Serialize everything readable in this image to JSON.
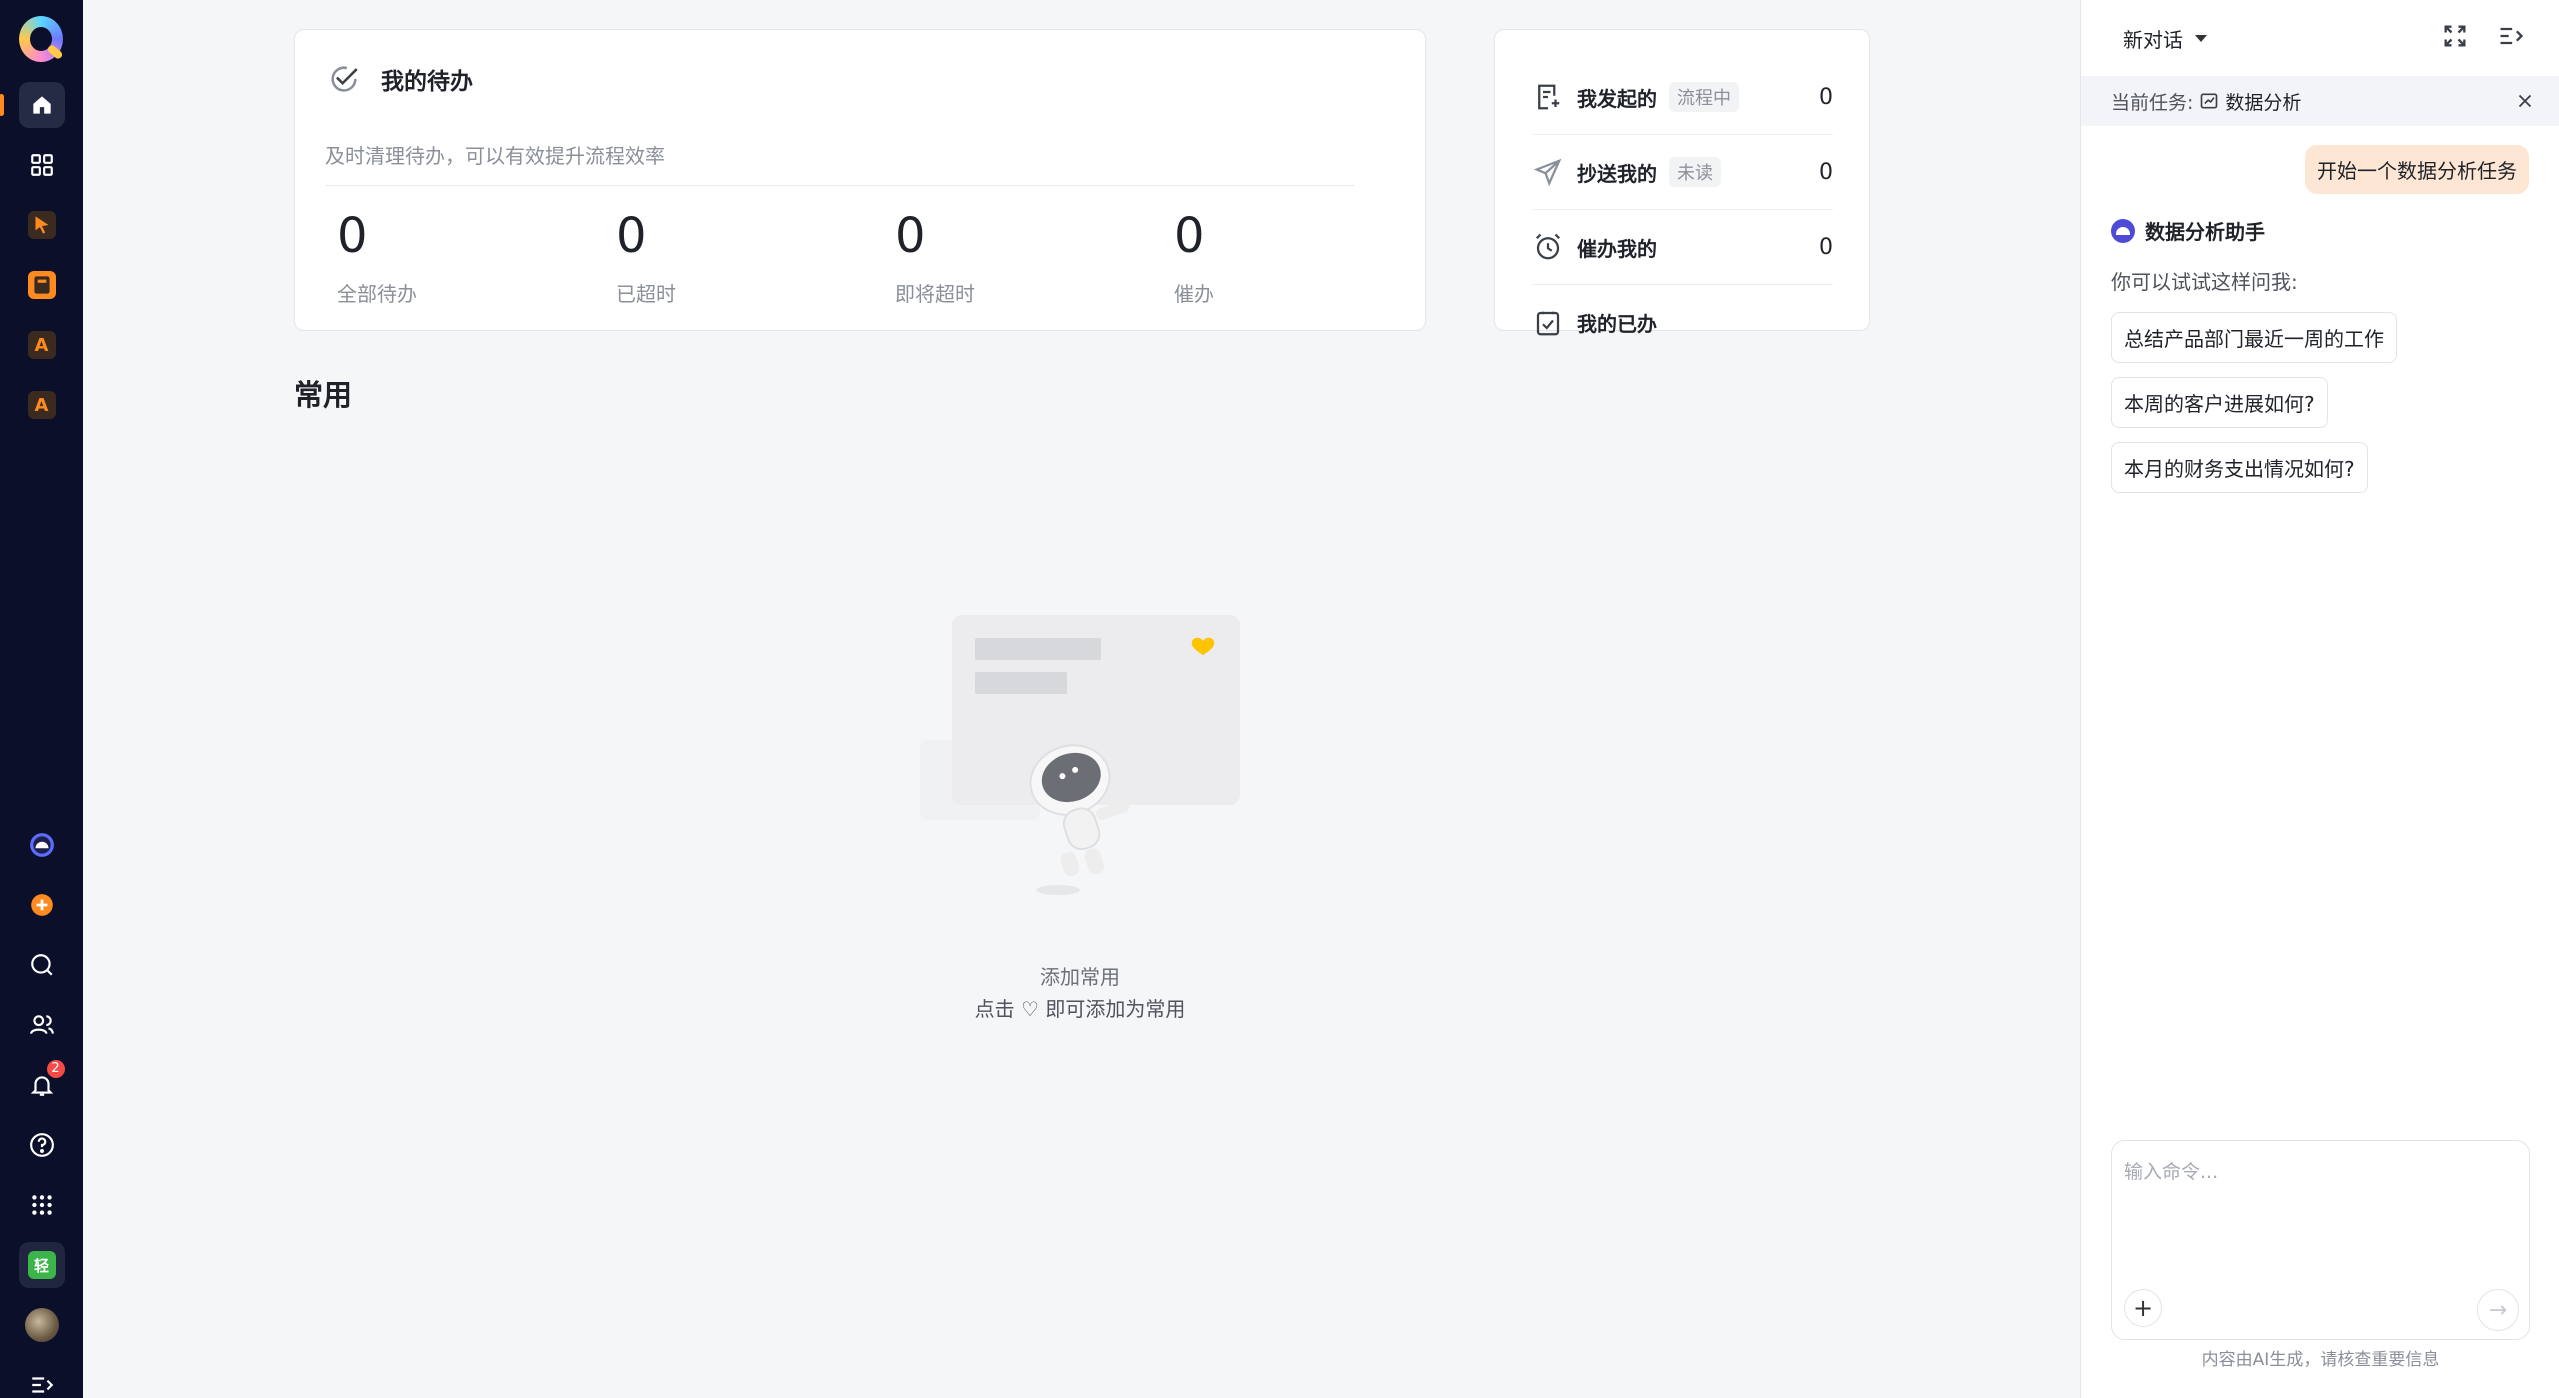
{
  "todo": {
    "title": "我的待办",
    "subtitle": "及时清理待办，可以有效提升流程效率",
    "stats": [
      {
        "value": "0",
        "label": "全部待办"
      },
      {
        "value": "0",
        "label": "已超时"
      },
      {
        "value": "0",
        "label": "即将超时"
      },
      {
        "value": "0",
        "label": "催办"
      }
    ]
  },
  "side_list": [
    {
      "name": "我发起的",
      "tag": "流程中",
      "count": "0",
      "icon": "doc-add-icon"
    },
    {
      "name": "抄送我的",
      "tag": "未读",
      "count": "0",
      "icon": "send-icon"
    },
    {
      "name": "催办我的",
      "tag": "",
      "count": "0",
      "icon": "alarm-icon"
    },
    {
      "name": "我的已办",
      "tag": "",
      "count": "",
      "icon": "checked-box-icon"
    }
  ],
  "common": {
    "title": "常用",
    "empty_title": "添加常用",
    "empty_hint": "点击 ♡ 即可添加为常用"
  },
  "rail": {
    "notification_badge": "2",
    "accent": "#ff8a1f",
    "apps": [
      {
        "letter": "",
        "color": "#ff8a1f"
      },
      {
        "letter": "",
        "color": "#ff8a1f"
      },
      {
        "letter": "A",
        "color": "#ff8a1f"
      },
      {
        "letter": "A",
        "color": "#ff8a1f"
      },
      {
        "letter": "轻",
        "color": "#3bb54a"
      }
    ]
  },
  "assistant": {
    "conversation": "新对话",
    "task_label": "当前任务:",
    "task_name": "数据分析",
    "user_message": "开始一个数据分析任务",
    "bot_name": "数据分析助手",
    "bot_intro": "你可以试试这样问我:",
    "suggestions": [
      "总结产品部门最近一周的工作",
      "本周的客户进展如何?",
      "本月的财务支出情况如何?"
    ],
    "input_placeholder": "输入命令...",
    "disclaimer": "内容由AI生成，请核查重要信息"
  }
}
